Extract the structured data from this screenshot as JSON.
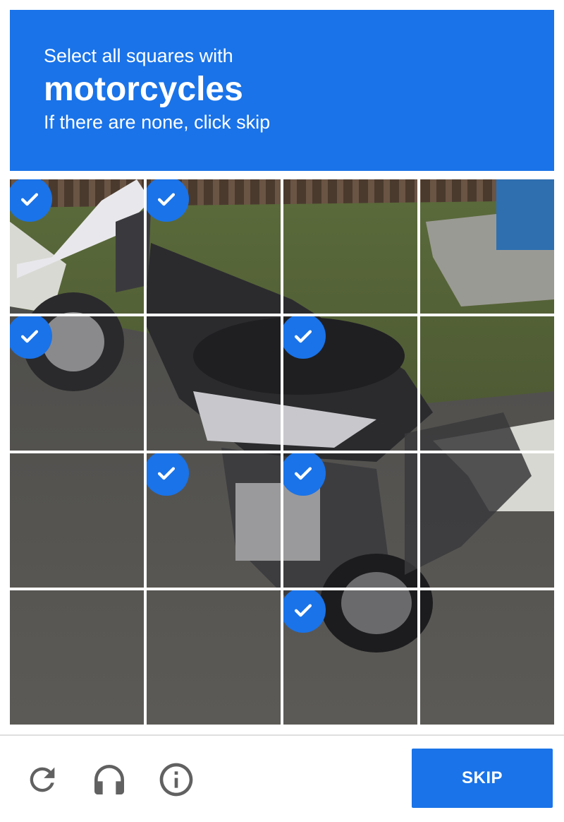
{
  "header": {
    "instruction": "Select all squares with",
    "keyword": "motorcycles",
    "hint": "If there are none, click skip"
  },
  "grid": {
    "rows": 4,
    "cols": 4,
    "selected": [
      [
        true,
        true,
        false,
        false
      ],
      [
        true,
        false,
        true,
        false
      ],
      [
        false,
        true,
        true,
        false
      ],
      [
        false,
        false,
        true,
        false
      ]
    ]
  },
  "footer": {
    "icons": [
      "reload-icon",
      "audio-headphones-icon",
      "info-icon"
    ],
    "skip_label": "SKIP"
  },
  "colors": {
    "accent": "#1a73e8",
    "icon_gray": "#616161",
    "checkmark": "#ffffff"
  }
}
